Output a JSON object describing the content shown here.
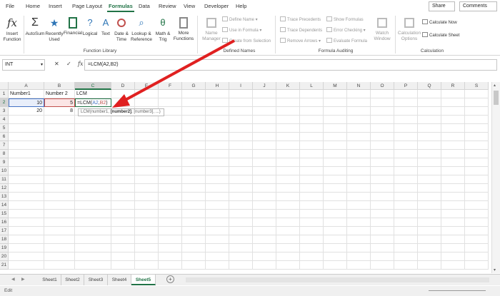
{
  "tabs": [
    "File",
    "Home",
    "Insert",
    "Page Layout",
    "Formulas",
    "Data",
    "Review",
    "View",
    "Developer",
    "Help"
  ],
  "active_tab": "Formulas",
  "share_label": "Share",
  "comments_label": "Comments",
  "ribbon": {
    "insert_function": [
      "Insert",
      "Function"
    ],
    "autosum": [
      "AutoSum",
      ""
    ],
    "recently_used": [
      "Recently",
      "Used"
    ],
    "financial": [
      "Financial",
      ""
    ],
    "logical": [
      "Logical",
      ""
    ],
    "text": [
      "Text",
      ""
    ],
    "date_time": [
      "Date &",
      "Time"
    ],
    "lookup": [
      "Lookup &",
      "Reference"
    ],
    "math_trig": [
      "Math &",
      "Trig"
    ],
    "more_functions": [
      "More",
      "Functions"
    ],
    "function_library_label": "Function Library",
    "name_manager": [
      "Name",
      "Manager"
    ],
    "define_name": "Define Name",
    "use_in_formula": "Use in Formula",
    "create_from_selection": "Create from Selection",
    "defined_names_label": "Defined Names",
    "trace_precedents": "Trace Precedents",
    "trace_dependents": "Trace Dependents",
    "remove_arrows": "Remove Arrows",
    "show_formulas": "Show Formulas",
    "error_checking": "Error Checking",
    "evaluate_formula": "Evaluate Formula",
    "watch_window": [
      "Watch",
      "Window"
    ],
    "formula_auditing_label": "Formula Auditing",
    "calc_options": [
      "Calculation",
      "Options"
    ],
    "calculate_now": "Calculate Now",
    "calculate_sheet": "Calculate Sheet",
    "calculation_label": "Calculation"
  },
  "name_box": "INT",
  "formula": "=LCM(A2,B2)",
  "columns": [
    "A",
    "B",
    "C",
    "D",
    "E",
    "F",
    "G",
    "H",
    "I",
    "J",
    "K",
    "L",
    "M",
    "N",
    "O",
    "P",
    "Q",
    "R",
    "S"
  ],
  "rows": [
    "1",
    "2",
    "3",
    "4",
    "5",
    "6",
    "7",
    "8",
    "9",
    "10",
    "11",
    "12",
    "13",
    "14",
    "15",
    "16",
    "17",
    "18",
    "19",
    "20",
    "21"
  ],
  "cells": {
    "a1": "Number1",
    "b1": "Number 2",
    "c1": "LCM",
    "a2": "10",
    "b2": "5",
    "c2_prefix": "=LCM(",
    "c2_ref1": "A2",
    "c2_comma": ",",
    "c2_ref2": "B2",
    "c2_close": ")",
    "a3": "20",
    "b3": "8"
  },
  "tooltip": {
    "prefix": "LCM(number1, ",
    "bold": "[number2]",
    "suffix": ", [number3], ...)"
  },
  "sheets": [
    "Sheet1",
    "Sheet2",
    "Sheet3",
    "Sheet4",
    "Sheet5"
  ],
  "active_sheet": "Sheet5",
  "status_mode": "Edit",
  "colors": {
    "accent": "#217346",
    "ref_blue": "#4472c4",
    "ref_red": "#c0504d",
    "arrow": "#e02020"
  }
}
